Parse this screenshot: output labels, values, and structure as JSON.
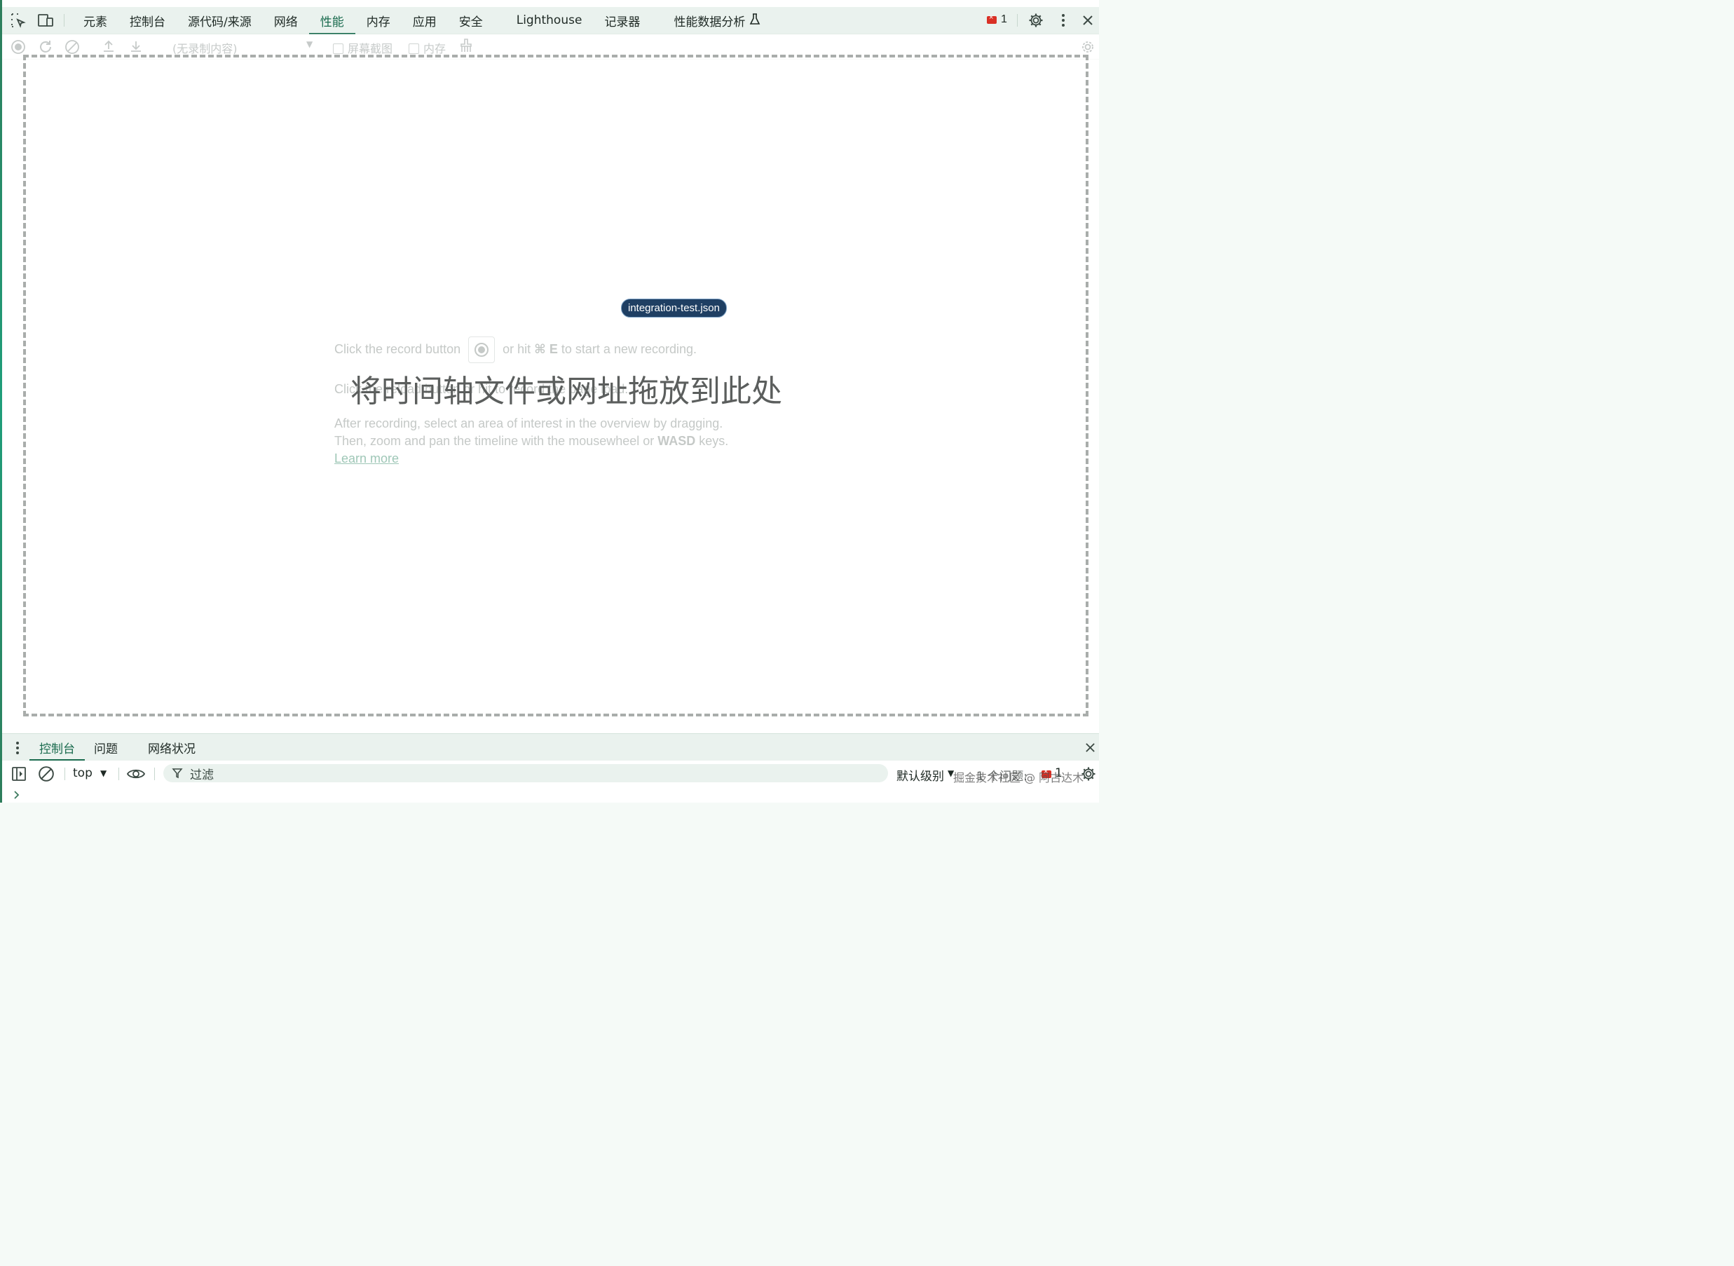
{
  "devtools": {
    "tabs": [
      {
        "label": "元素"
      },
      {
        "label": "控制台"
      },
      {
        "label": "源代码/来源"
      },
      {
        "label": "网络"
      },
      {
        "label": "性能",
        "active": true
      },
      {
        "label": "内存"
      },
      {
        "label": "应用"
      },
      {
        "label": "安全"
      },
      {
        "label": "Lighthouse"
      },
      {
        "label": "记录器"
      },
      {
        "label": "性能数据分析"
      }
    ],
    "issues_count": "1"
  },
  "toolbar": {
    "recording_select": "(无录制内容)",
    "screenshots_label": "屏幕截图",
    "memory_label": "内存"
  },
  "landing": {
    "line1_before": "Click the record button",
    "line1_after": "or hit",
    "line1_key": "⌘ E",
    "line1_end": "to start a new recording.",
    "line2": "Click the reload button      or hit      to record the page load.",
    "line3": "After recording, select an area of interest in the overview by dragging.",
    "line4_before": "Then, zoom and pan the timeline with the mousewheel or",
    "line4_key": "WASD",
    "line4_after": "keys.",
    "learn_more": "Learn more",
    "drop_title": "将时间轴文件或网址拖放到此处",
    "dragged_file": "integration-test.json"
  },
  "drawer": {
    "tabs": [
      {
        "label": "控制台",
        "active": true
      },
      {
        "label": "问题"
      },
      {
        "label": "网络状况"
      }
    ],
    "context": "top",
    "filter_placeholder": "过滤",
    "level": "默认级别",
    "issues_text": "1 个问题:",
    "issues_count": "1"
  },
  "watermark": "掘金技术社区 @ 阿古达木",
  "colors": {
    "accent": "#1a6b4e",
    "tab_bar": "#eaf2ee",
    "chip": "#1f3f63"
  }
}
